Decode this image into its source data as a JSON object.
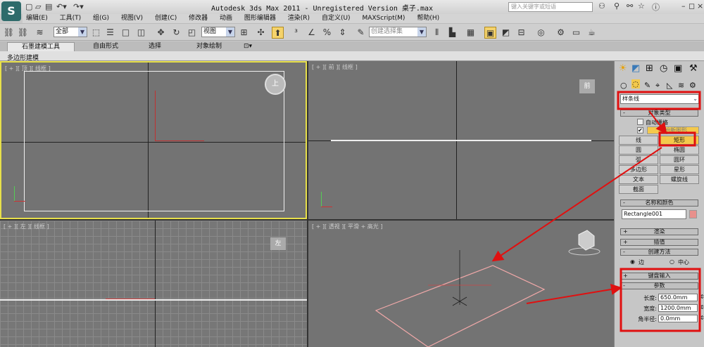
{
  "app": {
    "title": "Autodesk 3ds Max  2011  - Unregistered Version    桌子.max",
    "search_placeholder": "键入关键字或短语",
    "logo": "S"
  },
  "menu": [
    "编辑(E)",
    "工具(T)",
    "组(G)",
    "视图(V)",
    "创建(C)",
    "修改器",
    "动画",
    "图形编辑器",
    "渲染(R)",
    "自定义(U)",
    "MAXScript(M)",
    "帮助(H)"
  ],
  "toolbar": {
    "selection_filter": "全部",
    "reference_coord": "视图",
    "named_selection": "创建选择集"
  },
  "ribbon": {
    "tabs": [
      "石墨建模工具",
      "自由形式",
      "选择",
      "对象绘制"
    ],
    "active_tab": "石墨建模工具",
    "sub_panel": "多边形建模"
  },
  "viewports": [
    {
      "id": "top",
      "label": "[ + ][ 顶 ][ 线框 ]",
      "active": true,
      "cube": "上"
    },
    {
      "id": "front",
      "label": "[ + ][ 前 ][ 线框 ]",
      "active": false,
      "cube": "前"
    },
    {
      "id": "left",
      "label": "[ + ][ 左 ][ 线框 ]",
      "active": false,
      "cube": "左"
    },
    {
      "id": "persp",
      "label": "[ + ][ 透视 ][ 平滑 + 高光 ]",
      "active": false
    }
  ],
  "command_panel": {
    "category": "样条线",
    "object_type": {
      "title": "对象类型",
      "auto_grid": "自动栅格",
      "start_new_shape": "开始新图形",
      "buttons": [
        "线",
        "矩形",
        "圆",
        "椭圆",
        "弧",
        "圆环",
        "多边形",
        "星形",
        "文本",
        "螺旋线",
        "截面"
      ],
      "active": "矩形"
    },
    "name_color": {
      "title": "名称和颜色",
      "name": "Rectangle001",
      "color": "#e8908c"
    },
    "rollouts": {
      "rendering": "渲染",
      "interpolation": "插值",
      "creation_method": "创建方法",
      "keyboard_entry": "键盘输入",
      "parameters": "参数"
    },
    "creation": {
      "edge": "边",
      "center": "中心",
      "selected": "边"
    },
    "params": {
      "length_label": "长度:",
      "length": "650.0mm",
      "width_label": "宽度:",
      "width": "1200.0mm",
      "corner_label": "角半径:",
      "corner": "0.0mm"
    }
  },
  "colors": {
    "annotation": "#e01010",
    "active_border": "#e8e04a",
    "shape": "#f0a0a0"
  }
}
